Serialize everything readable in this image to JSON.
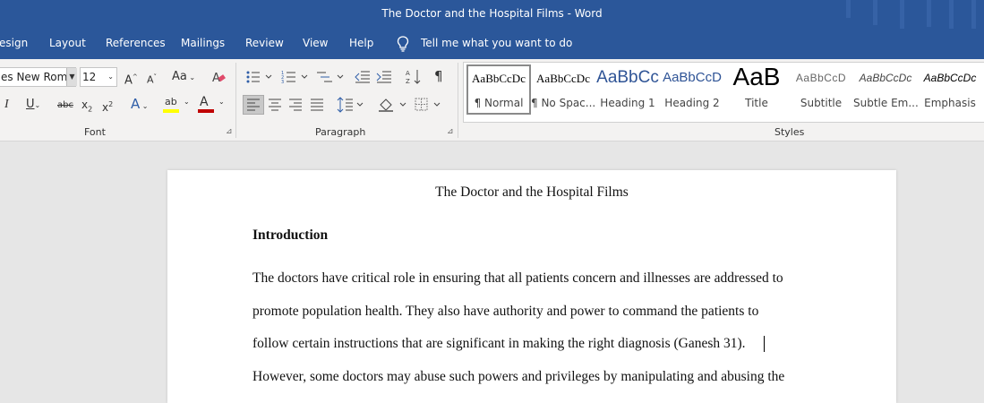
{
  "window": {
    "title": "The Doctor and the Hospital Films  -  Word"
  },
  "tabs": [
    {
      "label": "esign"
    },
    {
      "label": "Layout"
    },
    {
      "label": "References"
    },
    {
      "label": "Mailings"
    },
    {
      "label": "Review"
    },
    {
      "label": "View"
    },
    {
      "label": "Help"
    }
  ],
  "tell_me": {
    "text": "Tell me what you want to do",
    "icon": "lightbulb-icon"
  },
  "font_group": {
    "label": "Font",
    "font_name": "es New Roma",
    "font_size": "12",
    "grow_icon": "A^",
    "shrink_icon": "A˅",
    "change_case": "Aa",
    "italic": "I",
    "underline": "U",
    "strikethrough": "abc",
    "subscript": "x2",
    "superscript": "x2",
    "text_effects": "A",
    "highlight_text": "ab",
    "font_color_letter": "A",
    "font_color": "#c00000",
    "highlight_color": "#ffff00"
  },
  "paragraph_group": {
    "label": "Paragraph",
    "pilcrow": "¶"
  },
  "styles_group": {
    "label": "Styles",
    "items": [
      {
        "preview": "AaBbCcDc",
        "name": "¶ Normal"
      },
      {
        "preview": "AaBbCcDc",
        "name": "¶ No Spac..."
      },
      {
        "preview": "AaBbCc",
        "name": "Heading 1"
      },
      {
        "preview": "AaBbCcD",
        "name": "Heading 2"
      },
      {
        "preview": "AaB",
        "name": "Title"
      },
      {
        "preview": "AaBbCcD",
        "name": "Subtitle"
      },
      {
        "preview": "AaBbCcDc",
        "name": "Subtle Em..."
      },
      {
        "preview": "AaBbCcDc",
        "name": "Emphasis"
      }
    ]
  },
  "document": {
    "title": "The Doctor and the Hospital Films",
    "heading": "Introduction",
    "lines": [
      "The doctors have critical role in ensuring that all patients concern and illnesses are addressed to",
      "promote population health. They also have authority and power to command the patients to",
      "follow certain instructions that are significant in making the right diagnosis (Ganesh 31).",
      "However, some doctors may abuse such powers and privileges by manipulating and abusing the"
    ]
  },
  "colors": {
    "titlebar": "#2b579a",
    "ribbon": "#f3f2f1",
    "canvas": "#e6e6e6"
  }
}
